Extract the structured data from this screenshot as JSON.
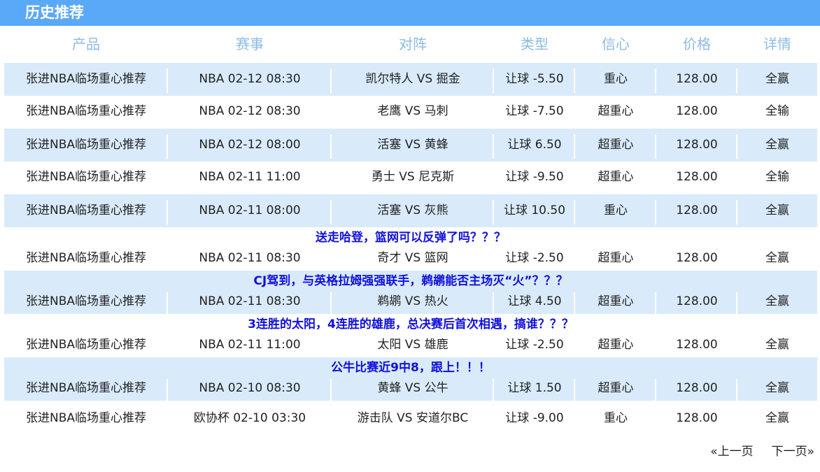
{
  "header": {
    "title": "历史推荐"
  },
  "columns": [
    "产品",
    "赛事",
    "对阵",
    "类型",
    "信心",
    "价格",
    "详情"
  ],
  "rows": [
    {
      "note": "",
      "product": "张进NBA临场重心推荐",
      "event": "NBA 02-12 08:30",
      "match": "凯尔特人 VS 掘金",
      "type": "让球 -5.50",
      "confidence": "重心",
      "price": "128.00",
      "detail": "全赢"
    },
    {
      "note": "",
      "product": "张进NBA临场重心推荐",
      "event": "NBA 02-12 08:30",
      "match": "老鹰 VS 马刺",
      "type": "让球 -7.50",
      "confidence": "超重心",
      "price": "128.00",
      "detail": "全输"
    },
    {
      "note": "",
      "product": "张进NBA临场重心推荐",
      "event": "NBA 02-12 08:00",
      "match": "活塞 VS 黄蜂",
      "type": "让球 6.50",
      "confidence": "超重心",
      "price": "128.00",
      "detail": "全赢"
    },
    {
      "note": "",
      "product": "张进NBA临场重心推荐",
      "event": "NBA 02-11 11:00",
      "match": "勇士 VS 尼克斯",
      "type": "让球 -9.50",
      "confidence": "超重心",
      "price": "128.00",
      "detail": "全输"
    },
    {
      "note": "",
      "product": "张进NBA临场重心推荐",
      "event": "NBA 02-11 08:00",
      "match": "活塞 VS 灰熊",
      "type": "让球 10.50",
      "confidence": "重心",
      "price": "128.00",
      "detail": "全赢"
    },
    {
      "note": "送走哈登，篮网可以反弹了吗？？？",
      "product": "张进NBA临场重心推荐",
      "event": "NBA 02-11 08:30",
      "match": "奇才 VS 篮网",
      "type": "让球 -2.50",
      "confidence": "超重心",
      "price": "128.00",
      "detail": "全赢"
    },
    {
      "note": "CJ驾到，与英格拉姆强强联手，鹈鹕能否主场灭“火”？？？",
      "product": "张进NBA临场重心推荐",
      "event": "NBA 02-11 08:30",
      "match": "鹈鹕 VS 热火",
      "type": "让球 4.50",
      "confidence": "超重心",
      "price": "128.00",
      "detail": "全赢"
    },
    {
      "note": "3连胜的太阳，4连胜的雄鹿，总决赛后首次相遇，搞谁？？？",
      "product": "张进NBA临场重心推荐",
      "event": "NBA 02-11 11:00",
      "match": "太阳 VS 雄鹿",
      "type": "让球 -2.50",
      "confidence": "超重心",
      "price": "128.00",
      "detail": "全赢"
    },
    {
      "note": "公牛比赛近9中8，跟上！！！",
      "product": "张进NBA临场重心推荐",
      "event": "NBA 02-10 08:30",
      "match": "黄蜂 VS 公牛",
      "type": "让球 1.50",
      "confidence": "超重心",
      "price": "128.00",
      "detail": "全赢"
    },
    {
      "note": "",
      "product": "张进NBA临场重心推荐",
      "event": "欧协杯 02-10 03:30",
      "match": "游击队 VS 安道尔BC",
      "type": "让球 -9.00",
      "confidence": "重心",
      "price": "128.00",
      "detail": "全赢"
    }
  ],
  "pager": {
    "prev": "«上一页",
    "next": "下一页»"
  },
  "colors": {
    "header_bg": "#5aa9f8",
    "row_alt_bg": "#d9ebfb",
    "column_header_text": "#8cbbe8",
    "note_text": "#1111dd"
  }
}
